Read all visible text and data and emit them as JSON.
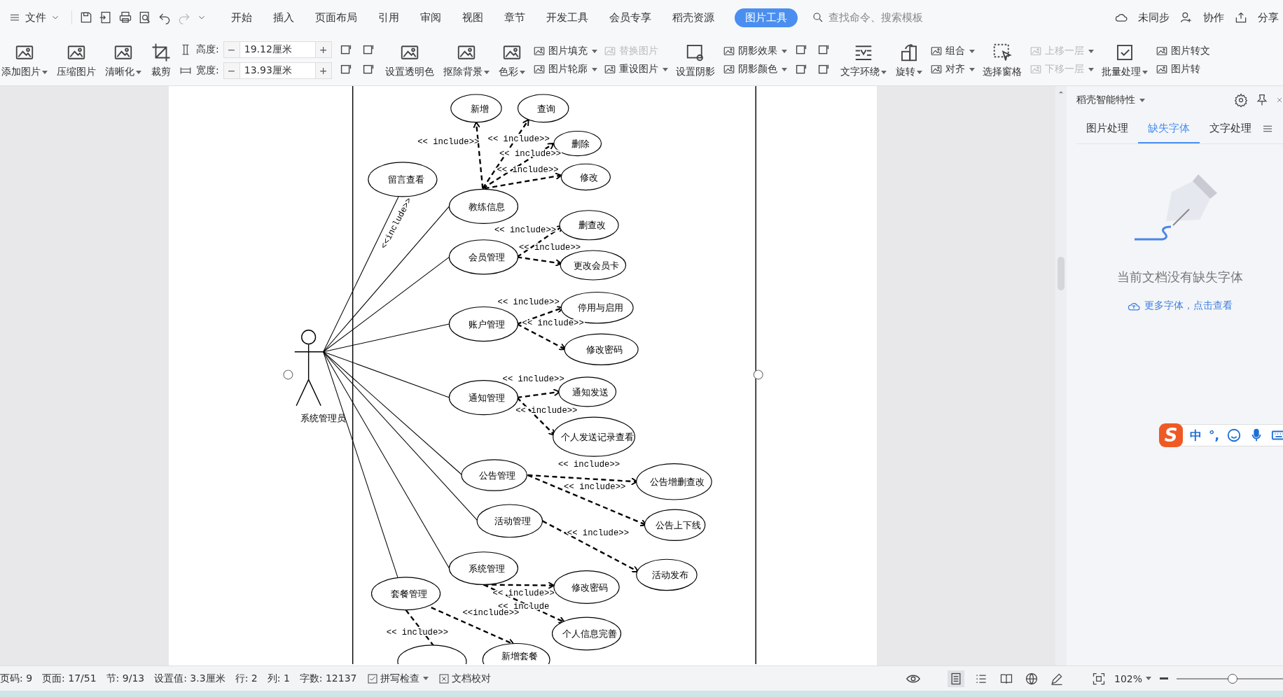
{
  "menu_bar": {
    "file_menu": "文件",
    "tabs": [
      {
        "label": "开始",
        "selected": false
      },
      {
        "label": "插入",
        "selected": false
      },
      {
        "label": "页面布局",
        "selected": false
      },
      {
        "label": "引用",
        "selected": false
      },
      {
        "label": "审阅",
        "selected": false
      },
      {
        "label": "视图",
        "selected": false
      },
      {
        "label": "章节",
        "selected": false
      },
      {
        "label": "开发工具",
        "selected": false
      },
      {
        "label": "会员专享",
        "selected": false
      },
      {
        "label": "稻壳资源",
        "selected": false
      },
      {
        "label": "图片工具",
        "selected": true
      }
    ],
    "search": {
      "placeholder": "查找命令、搜索模板"
    },
    "actions": [
      "未同步",
      "协作",
      "分享"
    ]
  },
  "ribbon": [
    {
      "kind": "large",
      "label": "添加图片",
      "dropdown": true
    },
    {
      "kind": "large",
      "label": "压缩图片",
      "dropdown": false
    },
    {
      "kind": "large",
      "label": "清晰化",
      "dropdown": true
    },
    {
      "kind": "large",
      "label": "裁剪",
      "dropdown": false
    },
    {
      "kind": "size",
      "fields": [
        {
          "label": "高度:",
          "value": "19.12厘米",
          "decrement": "−",
          "increment": "+"
        },
        {
          "label": "宽度:",
          "value": "13.93厘米",
          "decrement": "−",
          "increment": "+"
        }
      ]
    },
    {
      "kind": "icons"
    },
    {
      "kind": "large",
      "label": "设置透明色",
      "dropdown": false
    },
    {
      "kind": "large",
      "label": "抠除背景",
      "dropdown": true
    },
    {
      "kind": "large",
      "label": "色彩",
      "dropdown": true
    },
    {
      "kind": "stack",
      "items": [
        {
          "label": "图片填充",
          "dropdown": true,
          "disabled": false
        },
        {
          "label": "图片轮廓",
          "dropdown": true,
          "disabled": false
        }
      ]
    },
    {
      "kind": "stack",
      "items": [
        {
          "label": "替换图片",
          "dropdown": false,
          "disabled": true
        },
        {
          "label": "重设图片",
          "dropdown": true,
          "disabled": false
        }
      ]
    },
    {
      "kind": "large",
      "label": "设置阴影",
      "dropdown": false
    },
    {
      "kind": "stack",
      "items": [
        {
          "label": "阴影效果",
          "dropdown": true,
          "disabled": false
        },
        {
          "label": "阴影颜色",
          "dropdown": true,
          "disabled": false
        }
      ]
    },
    {
      "kind": "icons"
    },
    {
      "kind": "large",
      "label": "文字环绕",
      "dropdown": true
    },
    {
      "kind": "large",
      "label": "旋转",
      "dropdown": true
    },
    {
      "kind": "stack",
      "items": [
        {
          "label": "组合",
          "dropdown": true,
          "disabled": false
        },
        {
          "label": "对齐",
          "dropdown": true,
          "disabled": false
        }
      ]
    },
    {
      "kind": "large",
      "label": "选择窗格",
      "dropdown": false
    },
    {
      "kind": "stack",
      "items": [
        {
          "label": "上移一层",
          "dropdown": true,
          "disabled": true
        },
        {
          "label": "下移一层",
          "dropdown": true,
          "disabled": true
        }
      ]
    },
    {
      "kind": "large",
      "label": "批量处理",
      "dropdown": true
    },
    {
      "kind": "stack",
      "items": [
        {
          "label": "图片转文",
          "dropdown": false,
          "disabled": false
        },
        {
          "label": "图片转",
          "dropdown": false,
          "disabled": false
        }
      ]
    }
  ],
  "diagram": {
    "actor": "系统管理员",
    "use_cases": [
      "新增",
      "查询",
      "删除",
      "修改",
      "留言查看",
      "教练信息",
      "删查改",
      "会员管理",
      "更改会员卡",
      "停用与启用",
      "账户管理",
      "修改密码",
      "通知管理",
      "通知发送",
      "个人发送记录查看",
      "公告管理",
      "公告增删查改",
      "活动管理",
      "公告上下线",
      "系统管理",
      "修改密码",
      "活动发布",
      "套餐管理",
      "个人信息完善",
      "新增套餐"
    ],
    "includes": [
      "<< include>>",
      "<< include>>",
      "<< include>>",
      "<< include>>",
      "<<include>>",
      "<< include>>",
      "<< include>>",
      "<< include>>",
      "<< include>>",
      "<< include>>",
      "<< include>>",
      "<< include>>",
      "<< include>>",
      "<< include>>",
      "<< include>>",
      "<< include",
      "<< include>>",
      "<<include>>"
    ]
  },
  "side_panel": {
    "title": "稻壳智能特性",
    "tabs": [
      {
        "label": "图片处理",
        "selected": false
      },
      {
        "label": "缺失字体",
        "selected": true
      },
      {
        "label": "文字处理",
        "selected": false
      }
    ],
    "message": "当前文档没有缺失字体",
    "link": "更多字体，点击查看"
  },
  "ime_bar": {
    "logo": "S",
    "mode": "中",
    "punctuation": "°,"
  },
  "status_bar": {
    "items": [
      "页码: 9",
      "页面: 17/51",
      "节: 9/13",
      "设置值: 3.3厘米",
      "行: 2",
      "列: 1",
      "字数: 12137"
    ],
    "spell_check": "拼写检查",
    "proofread": "文档校对",
    "zoom": "102%",
    "zoom_slider": {
      "level": 0.5
    }
  }
}
